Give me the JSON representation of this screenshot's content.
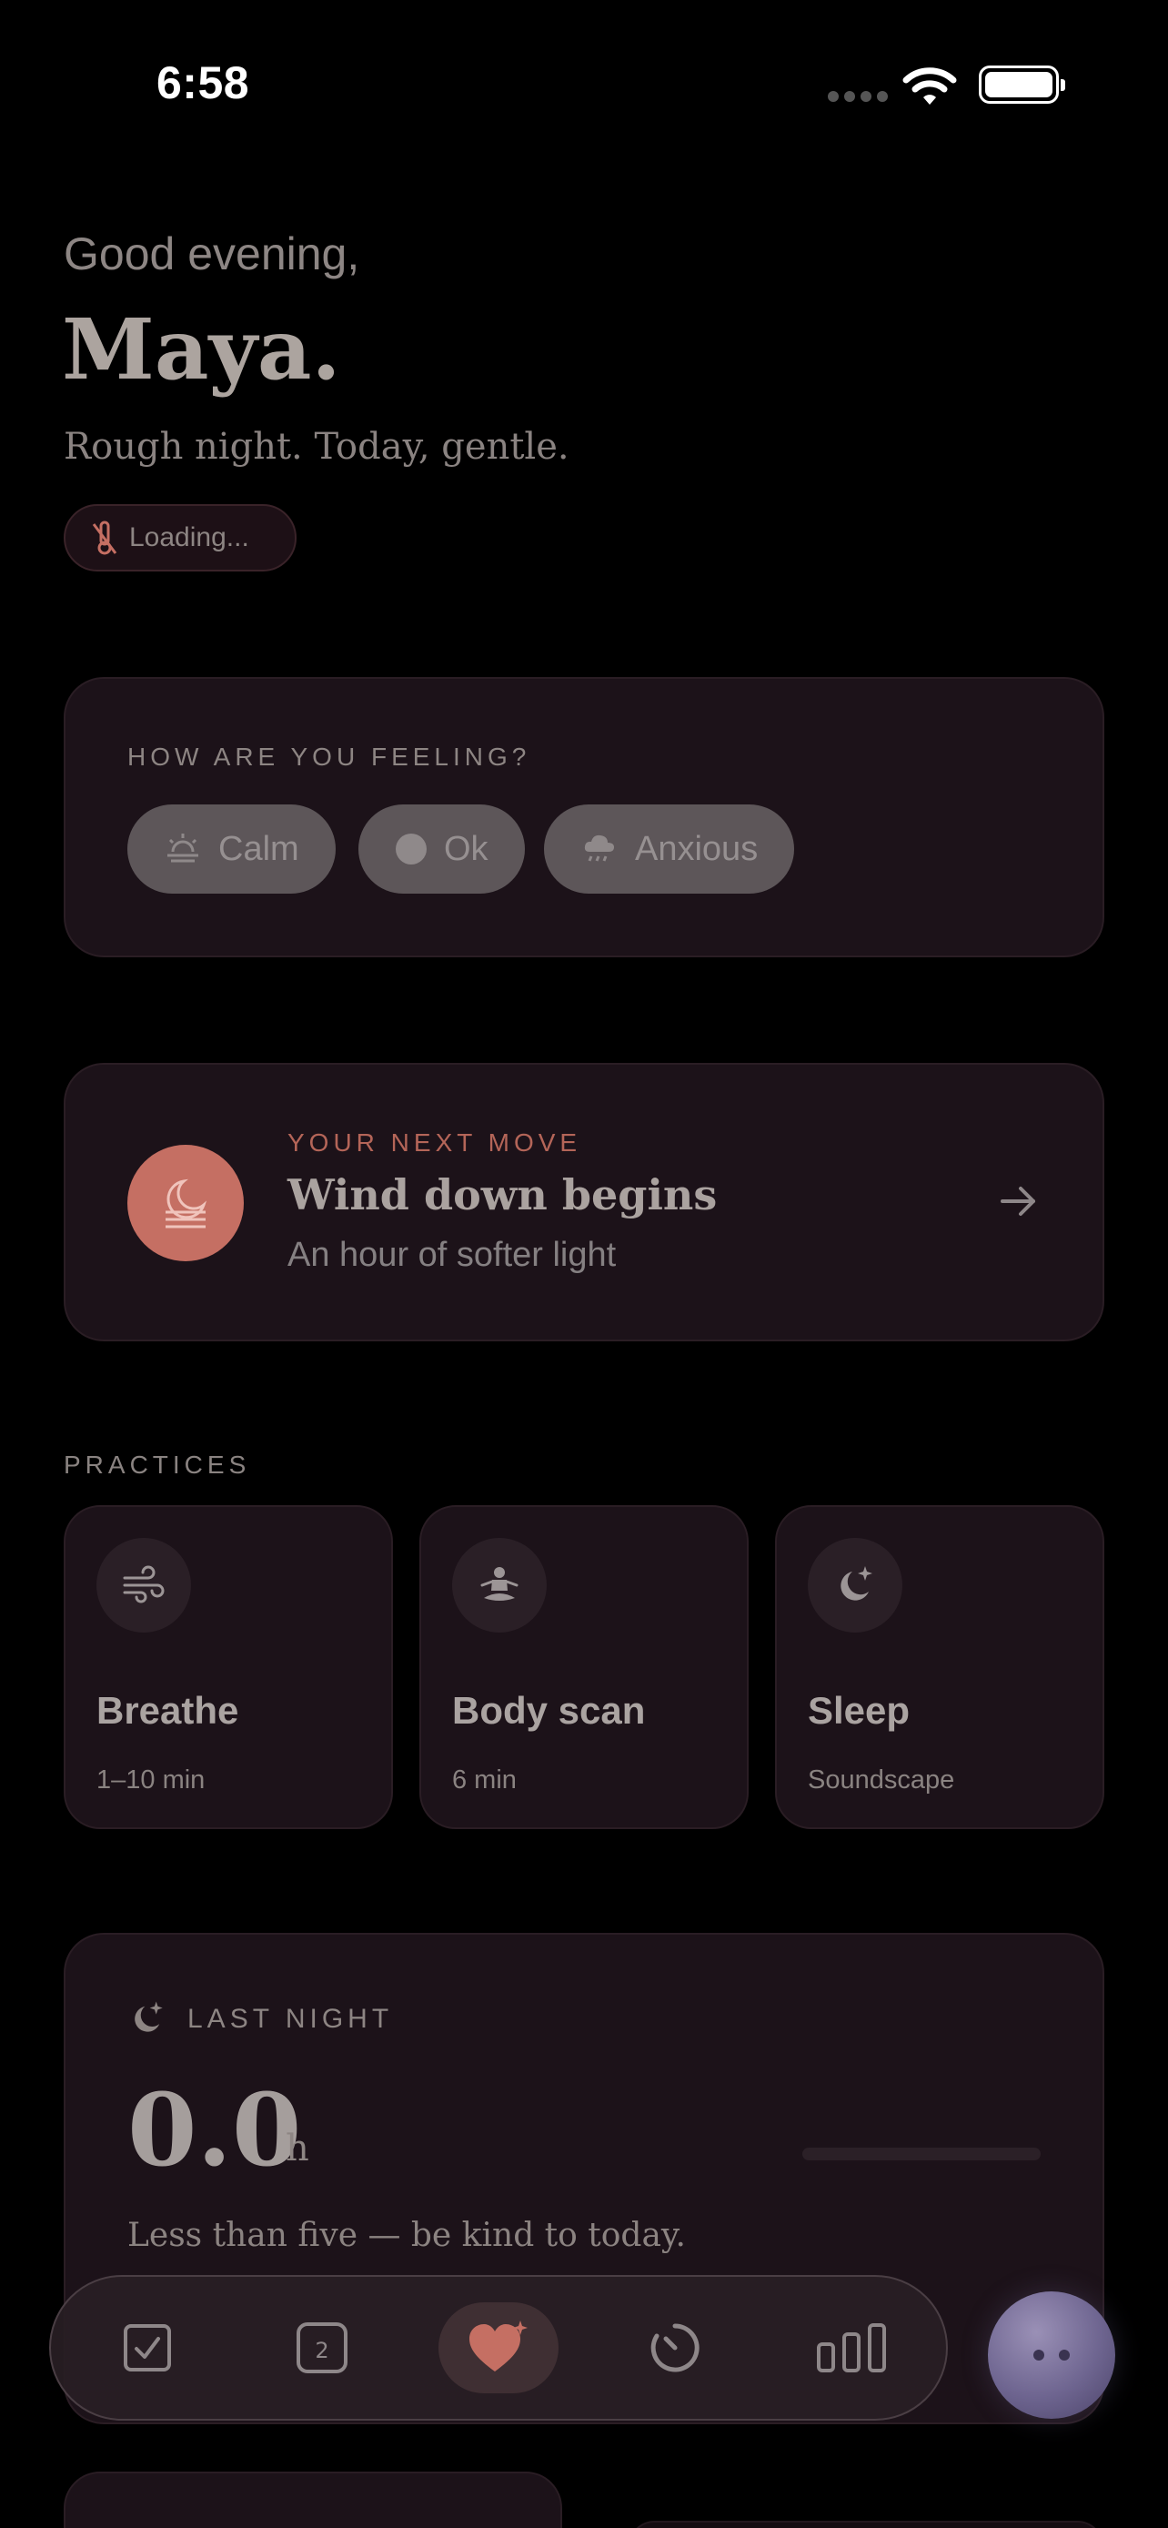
{
  "status_bar": {
    "time": "6:58"
  },
  "greeting": {
    "hello": "Good evening,",
    "name": "Maya.",
    "subtitle": "Rough night. Today, gentle.",
    "weather_pill": "Loading..."
  },
  "feeling": {
    "label": "HOW ARE YOU FEELING?",
    "options": [
      {
        "label": "Calm",
        "icon": "sunrise-icon"
      },
      {
        "label": "Ok",
        "icon": "dot-icon"
      },
      {
        "label": "Anxious",
        "icon": "rain-cloud-icon"
      }
    ]
  },
  "next_move": {
    "label": "YOUR NEXT MOVE",
    "title": "Wind down begins",
    "subtitle": "An hour of softer light",
    "icon": "moon-waves-icon",
    "accent": "#c56f63"
  },
  "practices": {
    "label": "PRACTICES",
    "items": [
      {
        "title": "Breathe",
        "subtitle": "1–10 min",
        "icon": "wind-icon"
      },
      {
        "title": "Body scan",
        "subtitle": "6 min",
        "icon": "meditation-icon"
      },
      {
        "title": "Sleep",
        "subtitle": "Soundscape",
        "icon": "moon-stars-icon"
      }
    ]
  },
  "last_night": {
    "label": "LAST NIGHT",
    "value": "0.0",
    "unit": "h",
    "note": "Less than five — be kind to today.",
    "progress": 0
  },
  "tab_bar": {
    "tabs": [
      {
        "name": "tasks",
        "icon": "checkbox-icon"
      },
      {
        "name": "calendar",
        "icon": "calendar-day-icon",
        "badge": "2"
      },
      {
        "name": "wellbeing",
        "icon": "heart-sparkle-icon",
        "active": true
      },
      {
        "name": "timer",
        "icon": "timer-icon"
      },
      {
        "name": "stats",
        "icon": "bar-chart-icon"
      }
    ]
  },
  "colors": {
    "background": "#000000",
    "card": "#1c1219",
    "accent": "#c56f63",
    "orb": "#7a70a0"
  }
}
